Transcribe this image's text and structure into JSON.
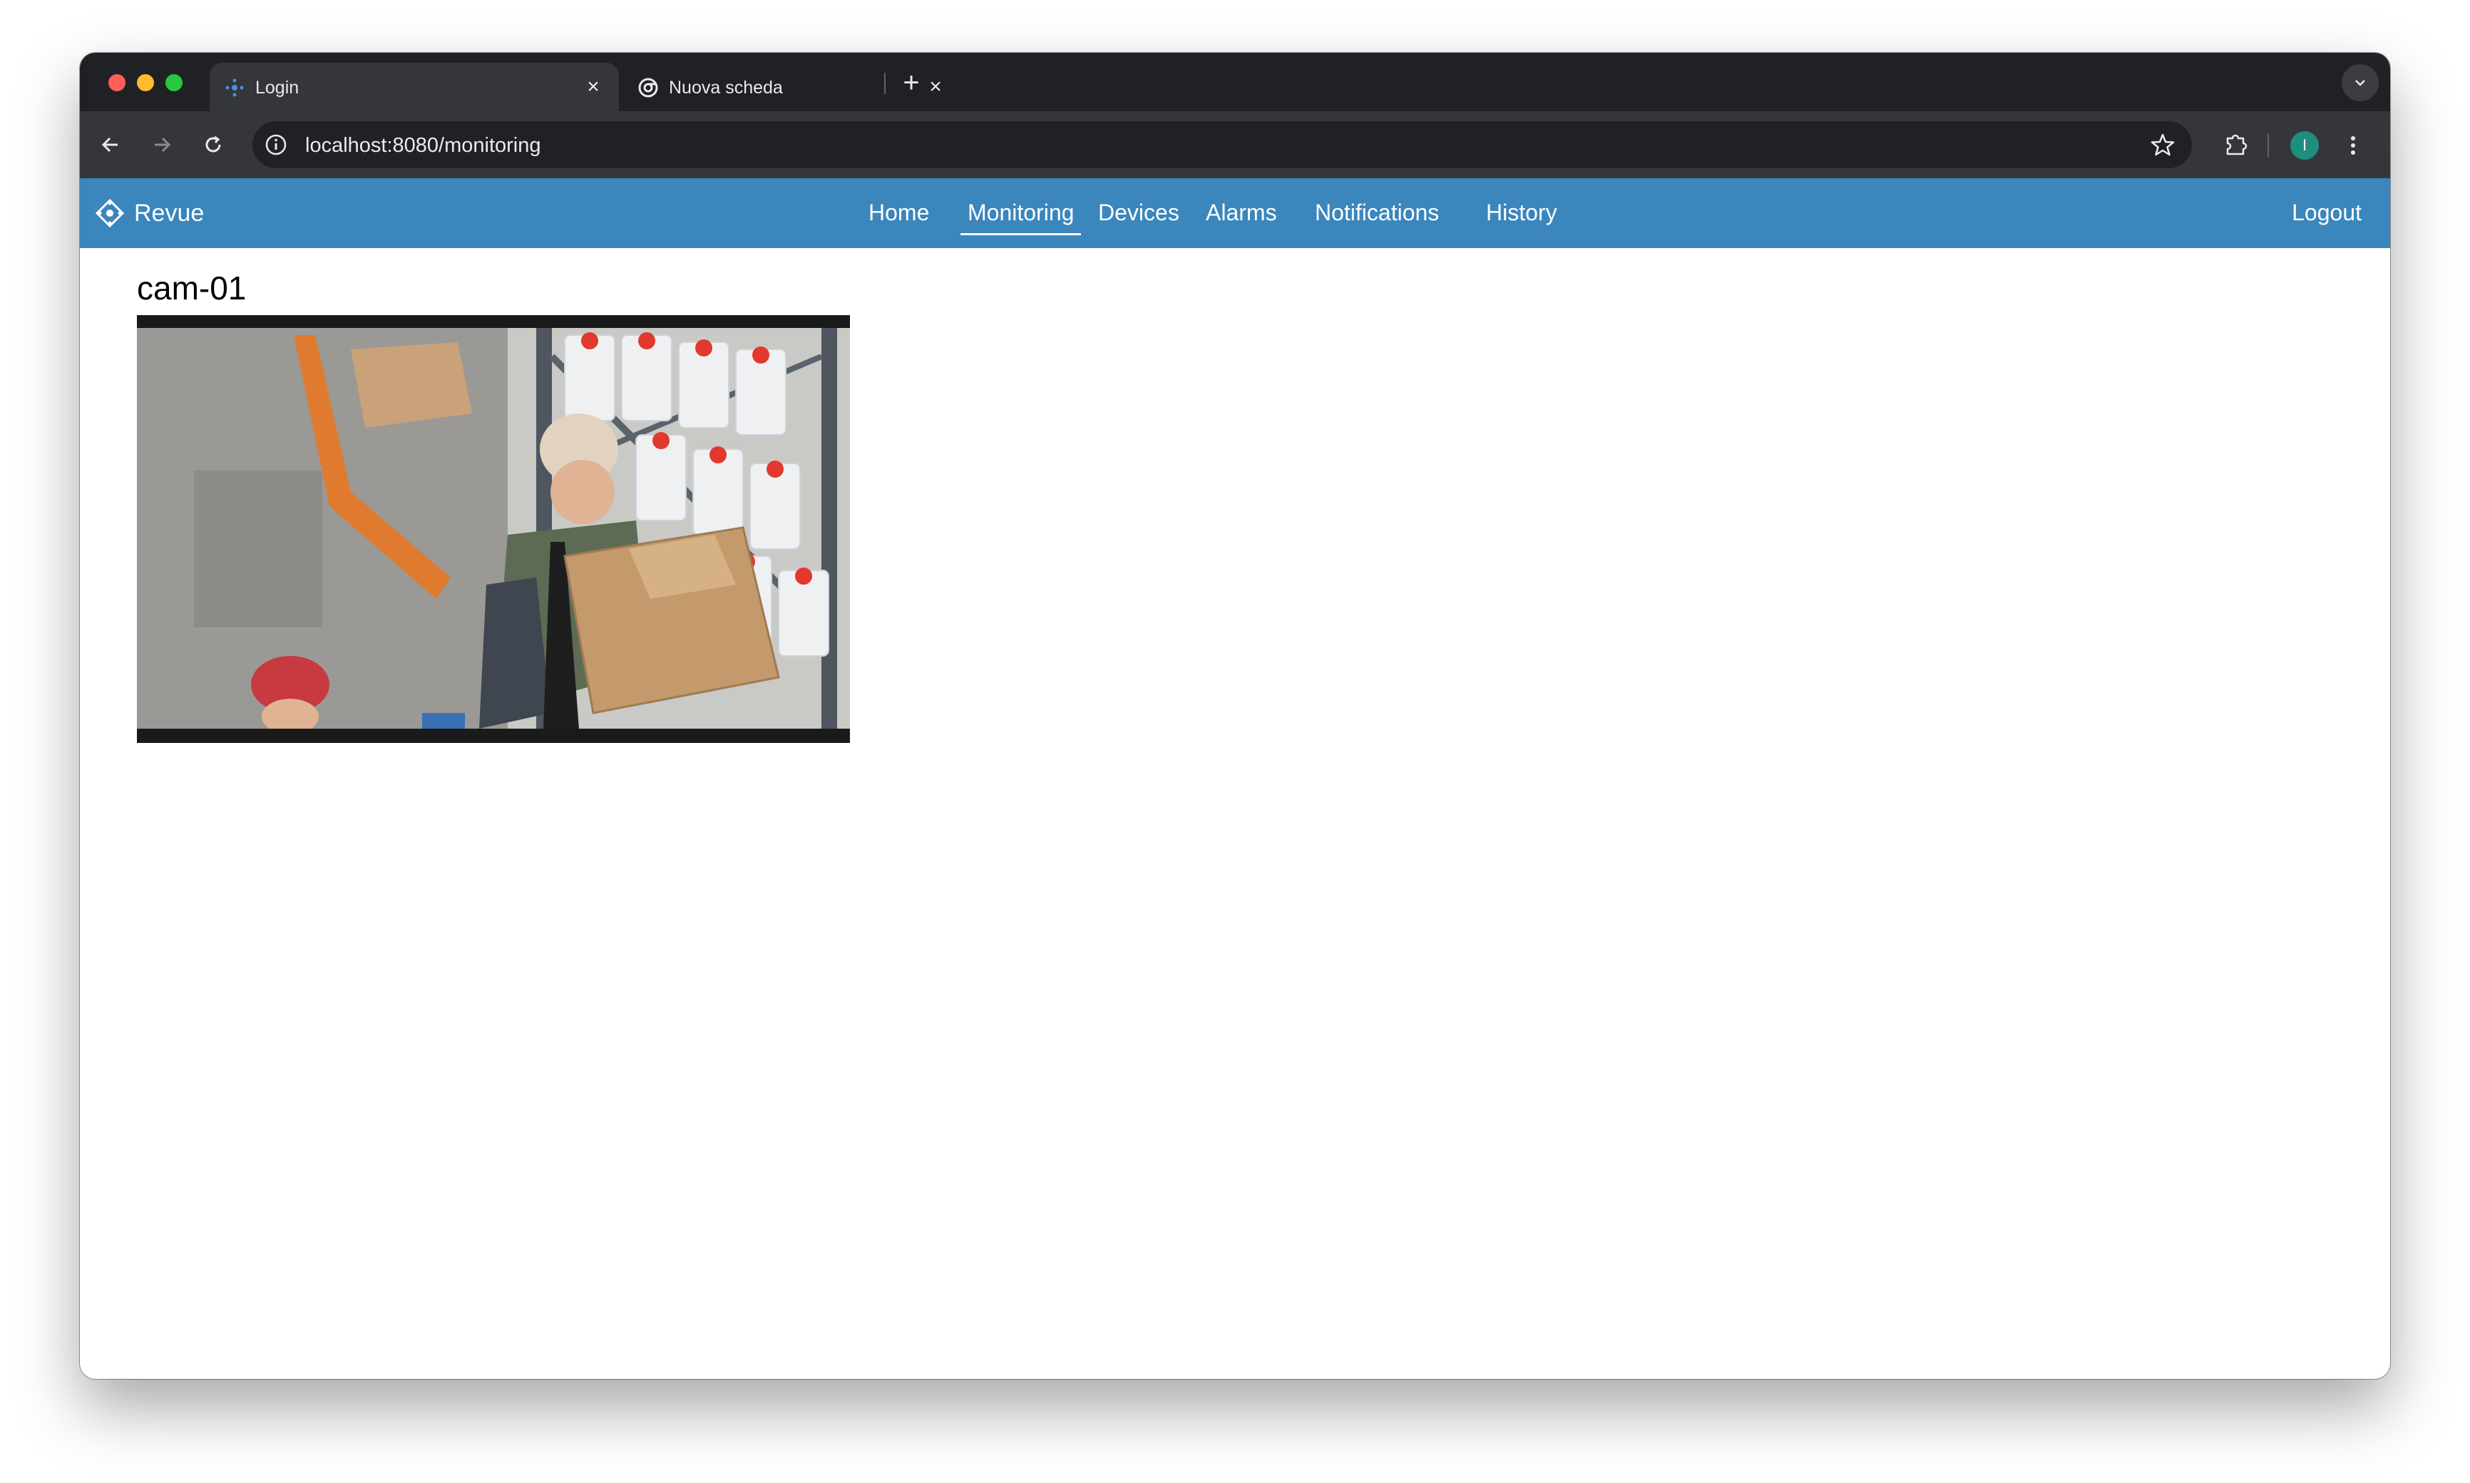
{
  "browser": {
    "tabs": [
      {
        "title": "Login",
        "active": true
      },
      {
        "title": "Nuova scheda",
        "active": false
      }
    ],
    "address_bar": {
      "url": "localhost:8080/monitoring"
    },
    "profile_initial": "I"
  },
  "app": {
    "brand": "Revue",
    "nav": [
      {
        "label": "Home",
        "active": false
      },
      {
        "label": "Monitoring",
        "active": true
      },
      {
        "label": "Devices",
        "active": false
      },
      {
        "label": "Alarms",
        "active": false
      },
      {
        "label": "Notifications",
        "active": false
      },
      {
        "label": "History",
        "active": false
      }
    ],
    "logout_label": "Logout",
    "accent_color": "#3a86bd"
  },
  "camera": {
    "title": "cam-01"
  }
}
